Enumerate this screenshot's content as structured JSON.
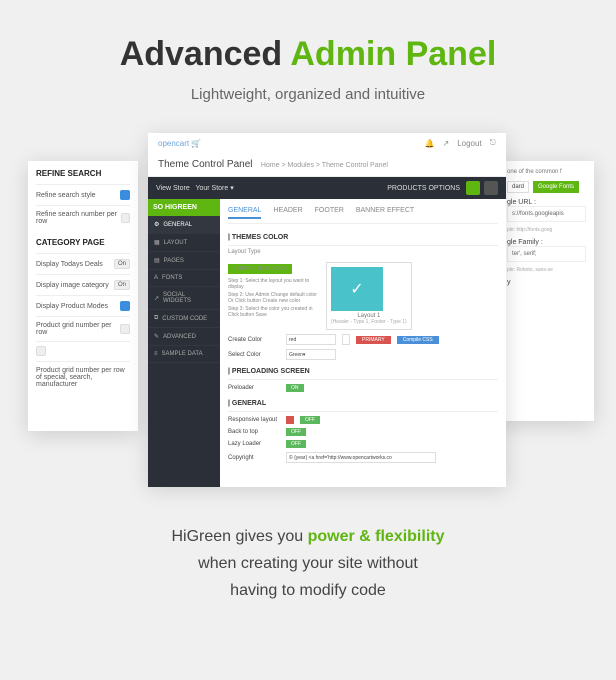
{
  "hero": {
    "title_a": "Advanced",
    "title_b": "Admin Panel",
    "sub": "Lightweight, organized and intuitive"
  },
  "left": {
    "h1": "REFINE SEARCH",
    "r1": "Refine search style",
    "r2": "Refine search number per row",
    "h2": "CATEGORY PAGE",
    "r3": "Display Todays Deals",
    "r3v": "On",
    "r4": "Display image category",
    "r4v": "On",
    "r5": "Display Product Modes",
    "r6": "Product grid number per row",
    "r7": "Product grid number per row of special, search, manufacturer"
  },
  "right": {
    "intro": "one of the common f",
    "tab1": "dard",
    "tab2": "Google Fonts",
    "l1": "gle URL :",
    "v1": "s://fonts.googleapis",
    "p1": "ple: http://fonts.goog",
    "l2": "gle Family :",
    "v2": "ter', serif;",
    "p2": "ple: Roboto, sans-se",
    "l3": "y"
  },
  "main": {
    "brand": "opencart",
    "top_right": "Logout",
    "title": "Theme Control Panel",
    "crumb": "Home > Modules > Theme Control Panel",
    "bar_l1": "View Store",
    "bar_l2": "Your Store ▾",
    "bar_r": "PRODUCTS OPTIONS",
    "side_brand": "SO HIGREEN",
    "side": [
      "GENERAL",
      "LAYOUT",
      "PAGES",
      "FONTS",
      "SOCIAL WIDGETS",
      "CUSTOM CODE",
      "ADVANCED",
      "SAMPLE DATA"
    ],
    "tabs": [
      "GENERAL",
      "HEADER",
      "FOOTER",
      "BANNER EFFECT"
    ],
    "sect1": "THEMES COLOR",
    "layout_lbl": "Layout Type",
    "new_btn": "+ CREATE NEW COLOR",
    "steps": [
      "Step 1: Select the layout you want to display",
      "Step 2: Use Admin Change default color Or Click button Create new color",
      "Step 3: Select the color you created in Click button Save"
    ],
    "layout_name": "Layout 1",
    "layout_sub": "(Header - Type 1, Footer - Type 1)",
    "create_lbl": "Create Color",
    "create_val": "red",
    "btn_pri": "PRIMARY",
    "btn_sec": "Compile CSS",
    "select_lbl": "Select Color",
    "select_val": "Green",
    "sect2": "PRELOADING SCREEN",
    "pre_lbl": "Preloader",
    "pre_val": "ON",
    "sect3": "GENERAL",
    "g1": "Responsive layout",
    "g1v": "OFF",
    "g2": "Back to top",
    "g2v": "OFF",
    "g3": "Lazy Loader",
    "g3v": "OFF",
    "g4": "Copyright",
    "g4v": "© {year} <a href='http://www.opencartworks.co"
  },
  "footer": {
    "l1a": "HiGreen gives you",
    "l1b": "power & flexibility",
    "l2": "when creating your site without",
    "l3": "having to modify code"
  }
}
